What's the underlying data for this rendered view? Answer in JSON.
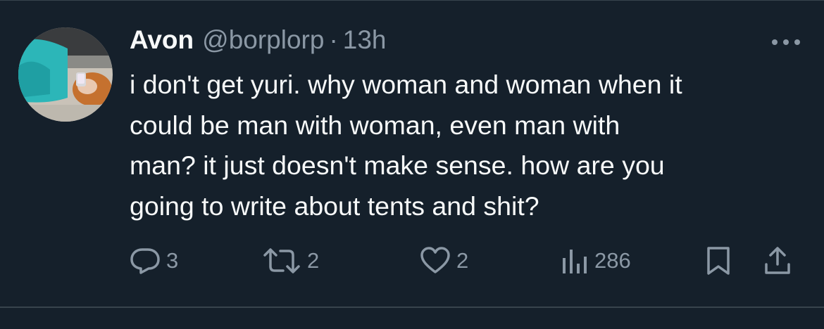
{
  "tweet": {
    "author": {
      "display_name": "Avon",
      "handle": "@borplorp",
      "avatar_icon": "profile-photo"
    },
    "separator": "·",
    "timestamp": "13h",
    "text_lines": [
      "i don't get yuri. why woman and woman when it",
      "could be man with woman, even man with",
      "man? it just doesn't make sense. how are you",
      "going to write about tents and shit?"
    ],
    "actions": {
      "reply_count": "3",
      "retweet_count": "2",
      "like_count": "2",
      "view_count": "286"
    },
    "icons": {
      "more": "more-dots-icon",
      "reply": "reply-icon",
      "retweet": "retweet-icon",
      "like": "heart-icon",
      "views": "views-chart-icon",
      "bookmark": "bookmark-icon",
      "share": "share-icon"
    }
  },
  "colors": {
    "background": "#15202b",
    "primary_text": "#f7f9f9",
    "secondary_text": "#8b98a5",
    "divider": "#38444d"
  }
}
